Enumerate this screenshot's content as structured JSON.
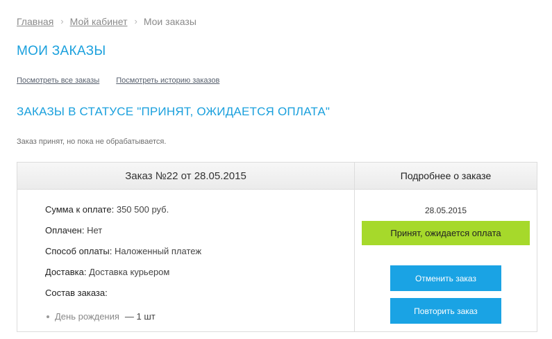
{
  "breadcrumb": {
    "home": "Главная",
    "cabinet": "Мой кабинет",
    "current": "Мои заказы",
    "separator": "›"
  },
  "page_title": "МОИ ЗАКАЗЫ",
  "links": {
    "all_orders": "Посмотреть все заказы",
    "order_history": "Посмотреть историю заказов"
  },
  "section_title": "ЗАКАЗЫ В СТАТУСЕ \"ПРИНЯТ, ОЖИДАЕТСЯ ОПЛАТА\"",
  "status_description": "Заказ принят, но пока не обрабатывается.",
  "order": {
    "header": "Заказ №22 от 28.05.2015",
    "details_header": "Подробнее о заказе",
    "sum_label": "Сумма к оплате:",
    "sum_value": "350 500 руб.",
    "paid_label": "Оплачен:",
    "paid_value": "Нет",
    "payment_label": "Способ оплаты:",
    "payment_value": "Наложенный платеж",
    "delivery_label": "Доставка:",
    "delivery_value": "Доставка курьером",
    "composition_label": "Состав заказа:",
    "items": [
      {
        "name": "День рождения",
        "qty": "— 1 шт"
      }
    ],
    "date": "28.05.2015",
    "status": "Принят, ожидается оплата",
    "cancel_label": "Отменить заказ",
    "repeat_label": "Повторить заказ"
  },
  "colors": {
    "accent": "#1aa0dd",
    "button": "#1aa3e4",
    "status_badge": "#a6d92b"
  }
}
